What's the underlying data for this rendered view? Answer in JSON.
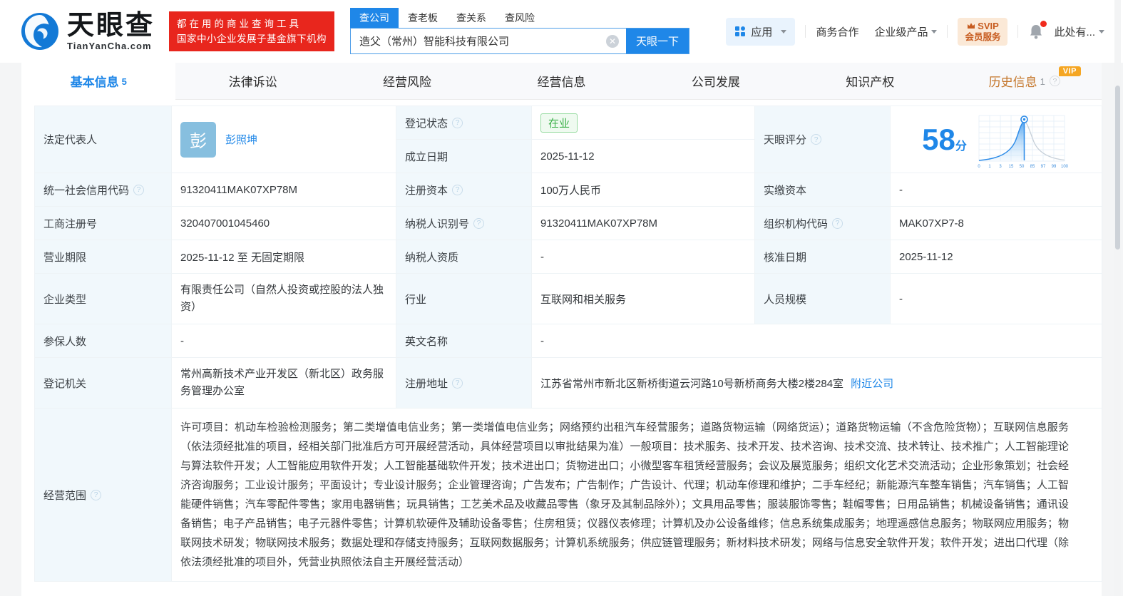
{
  "brand": {
    "name": "天眼查",
    "domain": "TianYanCha.com",
    "promo_line1": "都在用的商业查询工具",
    "promo_line2": "国家中小企业发展子基金旗下机构"
  },
  "search": {
    "tabs": [
      {
        "label": "查公司"
      },
      {
        "label": "查老板"
      },
      {
        "label": "查关系"
      },
      {
        "label": "查风险"
      }
    ],
    "value": "造父（常州）智能科技有限公司",
    "button": "天眼一下"
  },
  "topnav": {
    "apps": "应用",
    "cooperation": "商务合作",
    "enterprise": "企业级产品",
    "svip_line1": "SVIP",
    "svip_line2": "会员服务",
    "user": "此处有..."
  },
  "tabs": [
    {
      "label": "基本信息",
      "count": "5"
    },
    {
      "label": "法律诉讼"
    },
    {
      "label": "经营风险"
    },
    {
      "label": "经营信息"
    },
    {
      "label": "公司发展"
    },
    {
      "label": "知识产权"
    },
    {
      "label": "历史信息",
      "count": "1",
      "vip": "VIP"
    }
  ],
  "fields": {
    "legal_rep": {
      "label": "法定代表人",
      "avatar": "彭",
      "name": "彭照坤"
    },
    "reg_status": {
      "label": "登记状态",
      "value": "在业"
    },
    "establish_date": {
      "label": "成立日期",
      "value": "2025-11-12"
    },
    "score": {
      "label": "天眼评分",
      "value": "58",
      "unit": "分"
    },
    "credit_code": {
      "label": "统一社会信用代码",
      "value": "91320411MAK07XP78M"
    },
    "reg_capital": {
      "label": "注册资本",
      "value": "100万人民币"
    },
    "paid_capital": {
      "label": "实缴资本",
      "value": "-"
    },
    "reg_number": {
      "label": "工商注册号",
      "value": "320407001045460"
    },
    "taxpayer_id": {
      "label": "纳税人识别号",
      "value": "91320411MAK07XP78M"
    },
    "org_code": {
      "label": "组织机构代码",
      "value": "MAK07XP7-8"
    },
    "business_term": {
      "label": "营业期限",
      "value": "2025-11-12 至 无固定期限"
    },
    "taxpayer_quality": {
      "label": "纳税人资质",
      "value": "-"
    },
    "approval_date": {
      "label": "核准日期",
      "value": "2025-11-12"
    },
    "company_type": {
      "label": "企业类型",
      "value": "有限责任公司（自然人投资或控股的法人独资）"
    },
    "industry": {
      "label": "行业",
      "value": "互联网和相关服务"
    },
    "staff_size": {
      "label": "人员规模",
      "value": "-"
    },
    "insured_count": {
      "label": "参保人数",
      "value": "-"
    },
    "english_name": {
      "label": "英文名称",
      "value": "-"
    },
    "reg_authority": {
      "label": "登记机关",
      "value": "常州高新技术产业开发区（新北区）政务服务管理办公室"
    },
    "address": {
      "label": "注册地址",
      "value": "江苏省常州市新北区新桥街道云河路10号新桥商务大楼2楼284室",
      "link": "附近公司"
    },
    "business_scope": {
      "label": "经营范围",
      "value": "许可项目：机动车检验检测服务；第二类增值电信业务；第一类增值电信业务；网络预约出租汽车经营服务；道路货物运输（网络货运）；道路货物运输（不含危险货物）；互联网信息服务（依法须经批准的项目，经相关部门批准后方可开展经营活动，具体经营项目以审批结果为准）一般项目：技术服务、技术开发、技术咨询、技术交流、技术转让、技术推广；人工智能理论与算法软件开发；人工智能应用软件开发；人工智能基础软件开发；技术进出口；货物进出口；小微型客车租赁经营服务；会议及展览服务；组织文化艺术交流活动；企业形象策划；社会经济咨询服务；工业设计服务；平面设计；专业设计服务；企业管理咨询；广告发布；广告制作；广告设计、代理；机动车修理和维护；二手车经纪；新能源汽车整车销售；汽车销售；人工智能硬件销售；汽车零配件零售；家用电器销售；玩具销售；工艺美术品及收藏品零售（象牙及其制品除外）；文具用品零售；服装服饰零售；鞋帽零售；日用品销售；机械设备销售；通讯设备销售；电子产品销售；电子元器件零售；计算机软硬件及辅助设备零售；住房租赁；仪器仪表修理；计算机及办公设备维修；信息系统集成服务；地理遥感信息服务；物联网应用服务；物联网技术研发；物联网技术服务；数据处理和存储支持服务；互联网数据服务；计算机系统服务；供应链管理服务；新材料技术研发；网络与信息安全软件开发；软件开发；进出口代理（除依法须经批准的项目外，凭营业执照依法自主开展经营活动）"
    }
  },
  "score_chart": {
    "type": "line",
    "score": 58,
    "axis_labels": [
      "0",
      "1",
      "3",
      "15",
      "50",
      "85",
      "97",
      "99",
      "100"
    ]
  }
}
